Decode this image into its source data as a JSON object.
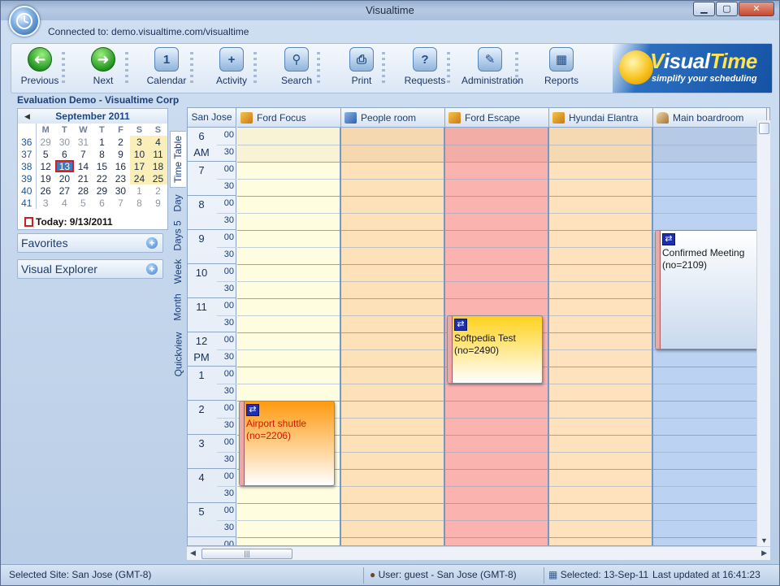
{
  "window": {
    "title": "Visualtime"
  },
  "connection": "Connected to: demo.visualtime.com/visualtime",
  "toolbar": [
    {
      "label": "Previous",
      "icon": "arrow-left-icon",
      "glyph": "➜"
    },
    {
      "label": "Next",
      "icon": "arrow-right-icon",
      "glyph": "➜"
    },
    {
      "label": "Calendar",
      "icon": "calendar-icon",
      "glyph": "1"
    },
    {
      "label": "Activity",
      "icon": "plus-circle-icon",
      "glyph": "+"
    },
    {
      "label": "Search",
      "icon": "magnifier-icon",
      "glyph": "⚲"
    },
    {
      "label": "Print",
      "icon": "printer-icon",
      "glyph": "⎙"
    },
    {
      "label": "Requests",
      "icon": "question-icon",
      "glyph": "?"
    },
    {
      "label": "Administration",
      "icon": "wrench-icon",
      "glyph": "✎"
    },
    {
      "label": "Reports",
      "icon": "grid-report-icon",
      "glyph": "▦"
    }
  ],
  "logo": {
    "brand_a": "V",
    "brand_b": "isual",
    "brand_c": "Time",
    "tagline": "simplify your scheduling"
  },
  "org_title": "Evaluation Demo  - Visualtime Corp",
  "mini_calendar": {
    "month": "September 2011",
    "prev": "◀",
    "next": "▶",
    "weekdays": [
      "M",
      "T",
      "W",
      "T",
      "F",
      "S",
      "S"
    ],
    "weeks": [
      {
        "wk": "36",
        "days": [
          "29",
          "30",
          "31",
          "1",
          "2",
          "3",
          "4"
        ]
      },
      {
        "wk": "37",
        "days": [
          "5",
          "6",
          "7",
          "8",
          "9",
          "10",
          "11"
        ]
      },
      {
        "wk": "38",
        "days": [
          "12",
          "13",
          "14",
          "15",
          "16",
          "17",
          "18"
        ]
      },
      {
        "wk": "39",
        "days": [
          "19",
          "20",
          "21",
          "22",
          "23",
          "24",
          "25"
        ]
      },
      {
        "wk": "40",
        "days": [
          "26",
          "27",
          "28",
          "29",
          "30",
          "1",
          "2"
        ]
      },
      {
        "wk": "41",
        "days": [
          "3",
          "4",
          "5",
          "6",
          "7",
          "8",
          "9"
        ]
      }
    ],
    "today_label": "Today: 9/13/2011"
  },
  "panels": {
    "favorites": "Favorites",
    "explorer": "Visual Explorer"
  },
  "view_tabs": [
    "Time Table",
    "Day",
    "Days 5",
    "Week",
    "Month",
    "Quickview"
  ],
  "schedule": {
    "timezone": "San Jose",
    "resources": [
      {
        "name": "Ford Focus",
        "icon": "car-icon",
        "kind": "car",
        "color": "#fffde0"
      },
      {
        "name": "People room",
        "icon": "room-icon",
        "kind": "room",
        "color": "#fde1b8"
      },
      {
        "name": "Ford Escape",
        "icon": "car-icon",
        "kind": "car",
        "color": "#fbb3b0"
      },
      {
        "name": "Hyundai Elantra",
        "icon": "car-icon",
        "kind": "car",
        "color": "#fde2bd"
      },
      {
        "name": "Main boardroom",
        "icon": "house-icon",
        "kind": "house",
        "color": "#bcd2f2"
      }
    ],
    "hours": [
      {
        "hour": "6",
        "ampm": "AM",
        "m1": "00",
        "m2": "30"
      },
      {
        "hour": "7",
        "ampm": "",
        "m1": "00",
        "m2": "30"
      },
      {
        "hour": "8",
        "ampm": "",
        "m1": "00",
        "m2": "30"
      },
      {
        "hour": "9",
        "ampm": "",
        "m1": "00",
        "m2": "30"
      },
      {
        "hour": "10",
        "ampm": "",
        "m1": "00",
        "m2": "30"
      },
      {
        "hour": "11",
        "ampm": "",
        "m1": "00",
        "m2": "30"
      },
      {
        "hour": "12",
        "ampm": "PM",
        "m1": "00",
        "m2": "30"
      },
      {
        "hour": "1",
        "ampm": "",
        "m1": "00",
        "m2": "30"
      },
      {
        "hour": "2",
        "ampm": "",
        "m1": "00",
        "m2": "30"
      },
      {
        "hour": "3",
        "ampm": "",
        "m1": "00",
        "m2": "30"
      },
      {
        "hour": "4",
        "ampm": "",
        "m1": "00",
        "m2": "30"
      },
      {
        "hour": "5",
        "ampm": "",
        "m1": "00",
        "m2": "30"
      },
      {
        "hour": "",
        "ampm": "",
        "m1": "00",
        "m2": ""
      }
    ],
    "appointments": [
      {
        "resource": 0,
        "start": "2:00 PM",
        "end": "4:30 PM",
        "title": "Airport shuttle",
        "number": "(no=2206)",
        "title_color": "#cc1a00",
        "fill": [
          "#ff9a10",
          "#ffffff"
        ]
      },
      {
        "resource": 2,
        "start": "11:30 AM",
        "end": "1:30 PM",
        "title": "Softpedia Test",
        "number": "(no=2490)",
        "title_color": "#1a1a1a",
        "fill": [
          "#ffd21e",
          "#ffffff"
        ]
      },
      {
        "resource": 4,
        "start": "9:00 AM",
        "end": "12:30 PM",
        "title": "Confirmed Meeting",
        "number": "(no=2109)",
        "title_color": "#1a1a1a",
        "fill": [
          "#ffffff",
          "#c9d9ee"
        ]
      }
    ]
  },
  "status": {
    "site": "Selected Site: San Jose (GMT-8)",
    "user": "User: guest - San Jose (GMT-8)",
    "selected": "Selected: 13-Sep-11",
    "updated": "Last updated at 16:41:23"
  }
}
